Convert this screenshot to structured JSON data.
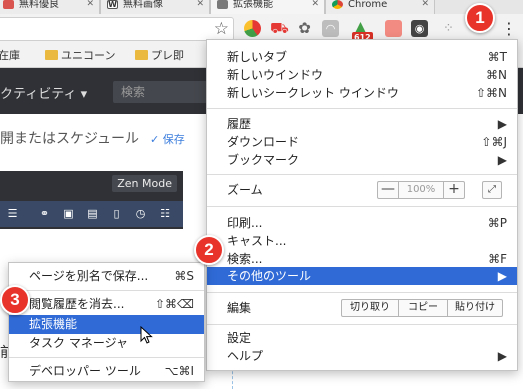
{
  "tabs": [
    {
      "label": "無料優良",
      "favicon_color": "#d9534f"
    },
    {
      "label": "無料画像",
      "favicon_color": "#222222"
    },
    {
      "label": "拡張機能",
      "favicon_color": "#7a7a7a"
    },
    {
      "label": "Chrome",
      "favicon_color": "#f4b400"
    }
  ],
  "toolbar": {
    "extension_badge": "612"
  },
  "bookmarks": [
    {
      "label": "在庫",
      "has_folder": false
    },
    {
      "label": "ユニコーン",
      "has_folder": true
    },
    {
      "label": "プレ即",
      "has_folder": true
    },
    {
      "label": "",
      "has_folder": true
    }
  ],
  "page": {
    "productivity_label": "クティビティ ▾",
    "search_placeholder": "検索",
    "schedule_text": "開またはスケジュール",
    "save_label": "✓ 保存",
    "zen_mode_label": "Zen Mode",
    "bottom_glyph": "前"
  },
  "main_menu": {
    "new_tab": {
      "label": "新しいタブ",
      "shortcut": "⌘T"
    },
    "new_window": {
      "label": "新しいウインドウ",
      "shortcut": "⌘N"
    },
    "new_incognito": {
      "label": "新しいシークレット ウインドウ",
      "shortcut": "⇧⌘N"
    },
    "history": {
      "label": "履歴",
      "shortcut": "▶"
    },
    "downloads": {
      "label": "ダウンロード",
      "shortcut": "⇧⌘J"
    },
    "bookmarks": {
      "label": "ブックマーク",
      "shortcut": "▶"
    },
    "zoom": {
      "label": "ズーム",
      "minus": "—",
      "value": "100%",
      "plus": "+",
      "fullscreen": "⤢"
    },
    "print": {
      "label": "印刷...",
      "shortcut": "⌘P"
    },
    "cast": {
      "label": "キャスト..."
    },
    "find": {
      "label": "検索...",
      "shortcut": "⌘F"
    },
    "more_tools": {
      "label": "その他のツール",
      "shortcut": "▶"
    },
    "edit": {
      "label": "編集",
      "cut": "切り取り",
      "copy": "コピー",
      "paste": "貼り付け"
    },
    "settings": {
      "label": "設定"
    },
    "help": {
      "label": "ヘルプ",
      "shortcut": "▶"
    }
  },
  "sub_menu": {
    "save_page": {
      "label": "ページを別名で保存...",
      "shortcut": "⌘S"
    },
    "clear_history": {
      "label": "閲覧履歴を消去...",
      "shortcut": "⇧⌘⌫"
    },
    "extensions": {
      "label": "拡張機能"
    },
    "task_manager": {
      "label": "タスク マネージャ"
    },
    "developer_tools": {
      "label": "デベロッパー ツール",
      "shortcut": "⌥⌘I"
    }
  },
  "steps": [
    "1",
    "2",
    "3"
  ],
  "colors": {
    "highlight": "#2f6ad6",
    "step_badge": "#e8332a",
    "app_bar": "#2f3136"
  }
}
